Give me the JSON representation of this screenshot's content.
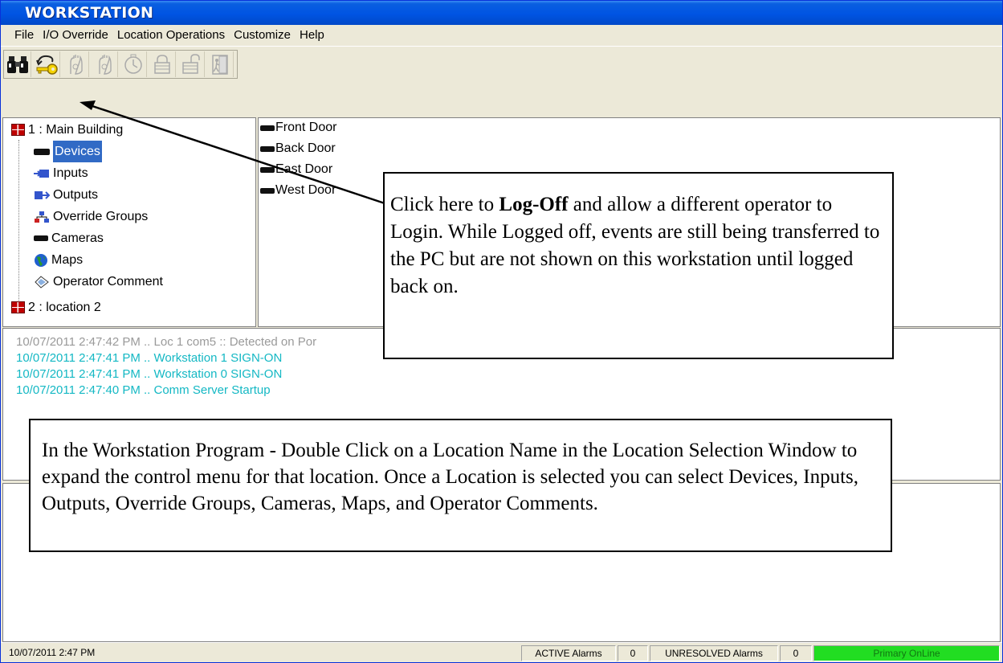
{
  "window": {
    "title": "WORKSTATION"
  },
  "menu": [
    "File",
    "I/O Override",
    "Location Operations",
    "Customize",
    "Help"
  ],
  "toolbar": {
    "buttons": [
      "binoculars-icon",
      "key-logoff-icon",
      "hand-icon",
      "hand-2-icon",
      "clock-icon",
      "lock-icon",
      "unlock-icon",
      "exit-door-icon"
    ]
  },
  "tree": {
    "location1": "1 :  Main Building",
    "items": [
      "Devices",
      "Inputs",
      "Outputs",
      "Override Groups",
      "Cameras",
      "Maps",
      "Operator Comment"
    ],
    "location2": "2 :  location 2"
  },
  "doors": [
    "Front Door",
    "Back Door",
    "East Door",
    "West Door"
  ],
  "events": [
    {
      "text": "10/07/2011 2:47:42 PM .. Loc 1  com5 :: Detected on Por",
      "color": "#9a9a9a"
    },
    {
      "text": "10/07/2011 2:47:41 PM .. Workstation 1 SIGN-ON",
      "color": "#14b8c4"
    },
    {
      "text": "10/07/2011 2:47:41 PM .. Workstation 0 SIGN-ON",
      "color": "#14b8c4"
    },
    {
      "text": "10/07/2011 2:47:40 PM .. Comm Server Startup",
      "color": "#14b8c4"
    }
  ],
  "callouts": {
    "logoff": {
      "before": "Click here to ",
      "bold": "Log-Off",
      "after": " and allow a different operator to Login. While Logged off, events are still being transferred to the PC but are not shown on this workstation until logged back on."
    },
    "workstation": "In the Workstation Program - Double Click on a Location Name in the Location Selection Window to expand the control menu for that location. Once a Location is selected you can select Devices, Inputs, Outputs, Override Groups, Cameras, Maps, and Operator Comments."
  },
  "status": {
    "datetime": "10/07/2011 2:47 PM",
    "active_label": "ACTIVE Alarms",
    "active_count": "0",
    "unresolved_label": "UNRESOLVED Alarms",
    "unresolved_count": "0",
    "online": "Primary OnLine",
    "online_color": "#22dd22"
  }
}
